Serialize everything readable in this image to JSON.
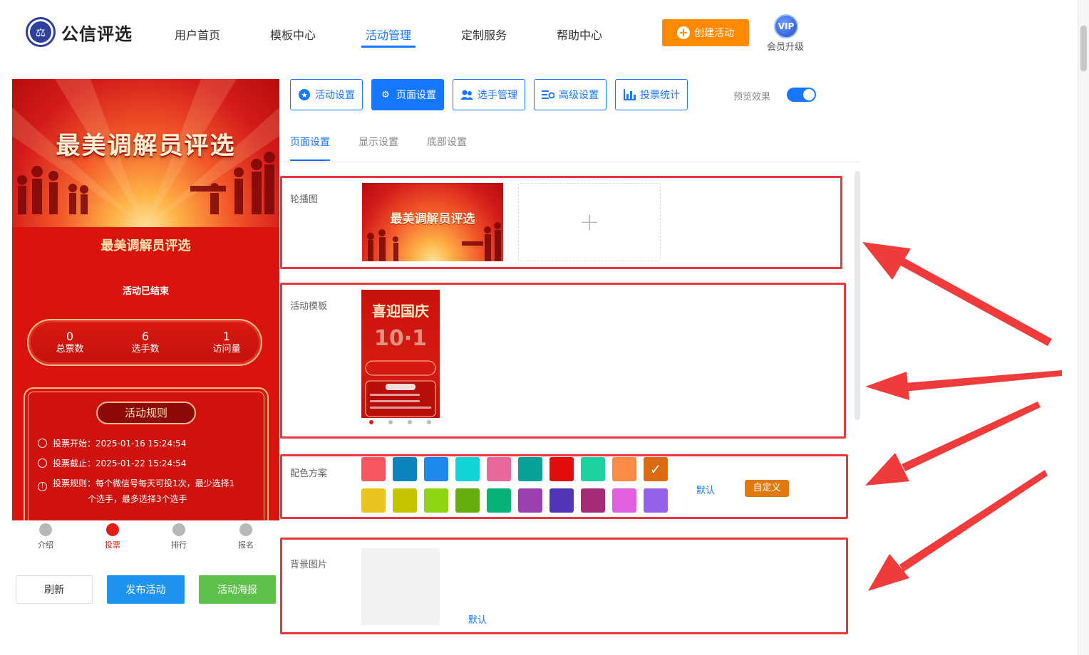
{
  "header": {
    "brand": "公信评选",
    "nav": [
      {
        "label": "用户首页"
      },
      {
        "label": "模板中心"
      },
      {
        "label": "活动管理"
      },
      {
        "label": "定制服务"
      },
      {
        "label": "帮助中心"
      }
    ],
    "active_nav": "活动管理",
    "create_button": "创建活动",
    "vip_badge": "VIP",
    "vip_label": "会员升级"
  },
  "preview": {
    "banner_title": "最美调解员评选",
    "title": "最美调解员评选",
    "status": "活动已结束",
    "stats": [
      {
        "value": "0",
        "label": "总票数"
      },
      {
        "value": "6",
        "label": "选手数"
      },
      {
        "value": "1",
        "label": "访问量"
      }
    ],
    "rules_title": "活动规则",
    "rules": [
      "投票开始：2025-01-16 15:24:54",
      "投票截止：2025-01-22 15:24:54",
      "投票规则：每个微信号每天可投1次，最少选择1"
    ],
    "rules_continued": "个选手，最多选择3个选手",
    "tabbar": [
      {
        "label": "介绍"
      },
      {
        "label": "投票"
      },
      {
        "label": "排行"
      },
      {
        "label": "报名"
      }
    ],
    "active_tab": "投票"
  },
  "actions": {
    "refresh": "刷新",
    "publish": "发布活动",
    "poster": "活动海报"
  },
  "settings_tabs": [
    {
      "label": "活动设置",
      "icon": "star-icon"
    },
    {
      "label": "页面设置",
      "icon": "gear-icon"
    },
    {
      "label": "选手管理",
      "icon": "users-icon"
    },
    {
      "label": "高级设置",
      "icon": "sliders-icon"
    },
    {
      "label": "投票统计",
      "icon": "bar-chart-icon"
    }
  ],
  "active_settings_tab": "页面设置",
  "preview_toggle": {
    "label": "预览效果",
    "on": true
  },
  "sub_tabs": [
    {
      "label": "页面设置"
    },
    {
      "label": "显示设置"
    },
    {
      "label": "底部设置"
    }
  ],
  "fields": {
    "carousel": {
      "label": "轮播图",
      "image_text": "最美调解员评选",
      "add_icon": "+"
    },
    "template": {
      "label": "活动模板",
      "image_text": "喜迎国庆"
    },
    "color_scheme": {
      "label": "配色方案",
      "row1": [
        "#f5565f",
        "#0d84be",
        "#1e88ee",
        "#12d4d4",
        "#e9689b",
        "#06a199",
        "#e20e0e",
        "#1ad3a0",
        "#ff8a45",
        "#dd6a10"
      ],
      "row2": [
        "#e9c41c",
        "#c6c400",
        "#8fd414",
        "#63ae0b",
        "#08b07a",
        "#9c3fb1",
        "#5235b7",
        "#a82b7a",
        "#e45ee0",
        "#9462ea"
      ],
      "selected_index": 9,
      "default_link": "默认",
      "custom_button": "自定义"
    },
    "background": {
      "label": "背景图片",
      "default_link": "默认"
    }
  },
  "colors": {
    "primary": "#1677ff",
    "accent_orange": "#ff8a00",
    "highlight_red": "#e8383d",
    "theme_red": "#d9140f"
  }
}
